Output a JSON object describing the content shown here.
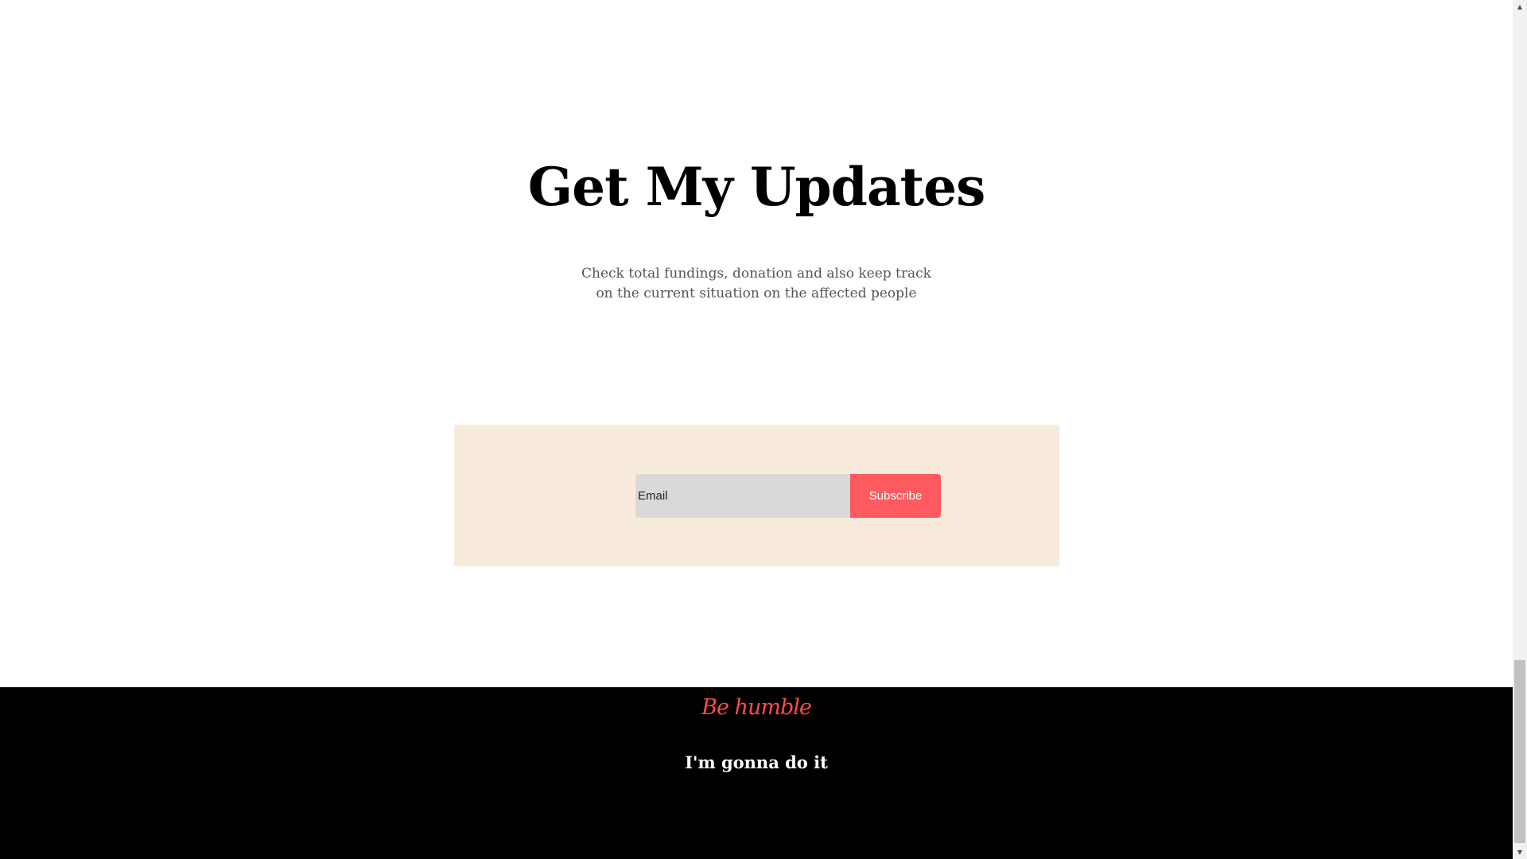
{
  "updates": {
    "title": "Get My Updates",
    "description_line1": "Check total fundings, donation and also keep track",
    "description_line2": "on the current situation on the affected people"
  },
  "subscribe_form": {
    "email_placeholder": "Email",
    "email_value": "",
    "button_label": "Subscribe",
    "panel_color": "#f9ebdb",
    "button_color": "#ff5a5f"
  },
  "footer": {
    "logo_text": "Be humble",
    "tagline": "I'm gonna do it",
    "background_color": "#000000",
    "logo_color": "#ff4a4a"
  },
  "scrollbar": {
    "up_icon": "chevron-up-icon",
    "down_icon": "chevron-down-icon"
  }
}
